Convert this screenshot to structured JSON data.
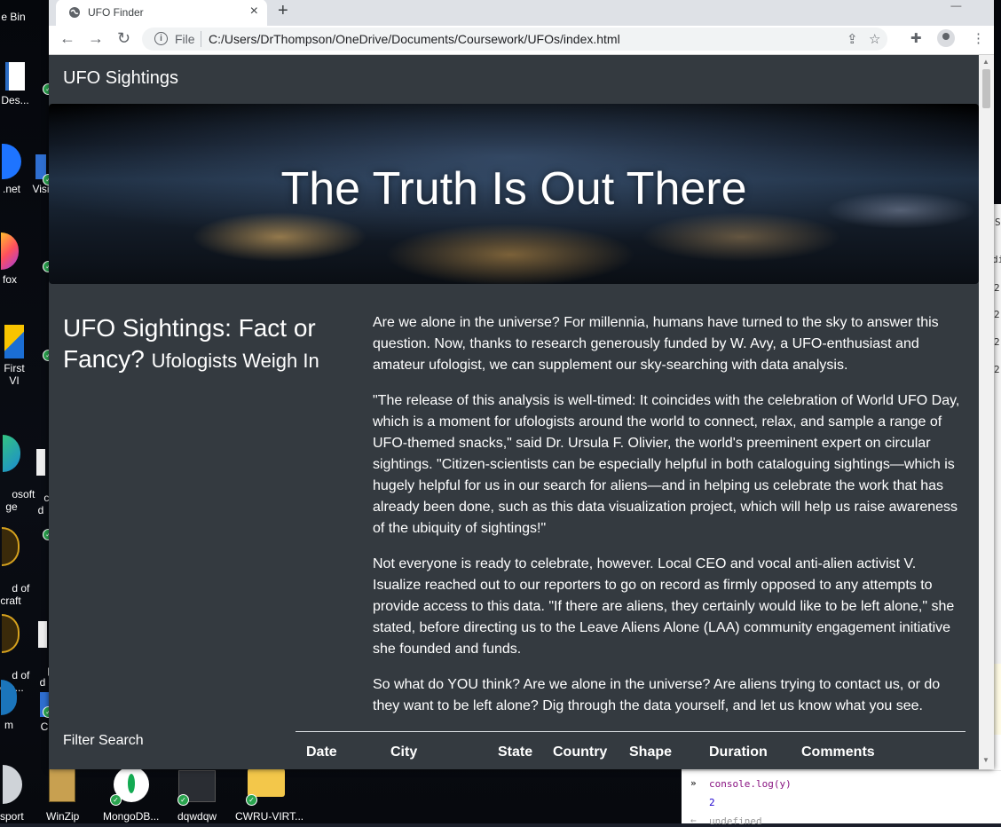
{
  "desktop": {
    "left_icons": [
      {
        "label": "e Bin"
      },
      {
        "label": "Des..."
      },
      {
        "label": ".net"
      },
      {
        "label": "Visi"
      },
      {
        "label": "fox"
      },
      {
        "label": "First VI"
      },
      {
        "label": "osoft\nge"
      },
      {
        "label": "calc\nd"
      },
      {
        "label": "d of\ncraft"
      },
      {
        "label": "d of\ncra..."
      },
      {
        "label": "p\nd"
      },
      {
        "label": "m"
      },
      {
        "label": "C"
      }
    ],
    "bottom_icons": [
      {
        "label": "sport"
      },
      {
        "label": "WinZip"
      },
      {
        "label": "MongoDB..."
      },
      {
        "label": "dqwdqw"
      },
      {
        "label": "CWRU-VIRT..."
      }
    ]
  },
  "devtools": {
    "console_line": "console.log(y)",
    "output": "2",
    "undefined_line": "undefined",
    "side_letters": [
      "S",
      "di",
      "2",
      "2",
      "2",
      "2"
    ]
  },
  "browser": {
    "tab_title": "UFO Finder",
    "file_label": "File",
    "url": "C:/Users/DrThompson/OneDrive/Documents/Coursework/UFOs/index.html"
  },
  "page": {
    "brand": "UFO Sightings",
    "hero_title": "The Truth Is Out There",
    "side_heading": "UFO Sightings: Fact or Fancy?",
    "side_subheading": "Ufologists Weigh In",
    "paragraphs": [
      "Are we alone in the universe? For millennia, humans have turned to the sky to answer this question. Now, thanks to research generously funded by W. Avy, a UFO-enthusiast and amateur ufologist, we can supplement our sky-searching with data analysis.",
      "\"The release of this analysis is well-timed: It coincides with the celebration of World UFO Day, which is a moment for ufologists around the world to connect, relax, and sample a range of UFO-themed snacks,\" said Dr. Ursula F. Olivier, the world's preeminent expert on circular sightings. \"Citizen-scientists can be especially helpful in both cataloguing sightings—which is hugely helpful for us in our search for aliens—and in helping us celebrate the work that has already been done, such as this data visualization project, which will help us raise awareness of the ubiquity of sightings!\"",
      "Not everyone is ready to celebrate, however. Local CEO and vocal anti-alien activist V. Isualize reached out to our reporters to go on record as firmly opposed to any attempts to provide access to this data. \"If there are aliens, they certainly would like to be left alone,\" she stated, before directing us to the Leave Aliens Alone (LAA) community engagement initiative she founded and funds.",
      "So what do YOU think? Are we alone in the universe? Are aliens trying to contact us, or do they want to be left alone? Dig through the data yourself, and let us know what you see."
    ],
    "filter_title": "Filter Search",
    "table_headers": [
      "Date",
      "City",
      "State",
      "Country",
      "Shape",
      "Duration",
      "Comments"
    ]
  }
}
